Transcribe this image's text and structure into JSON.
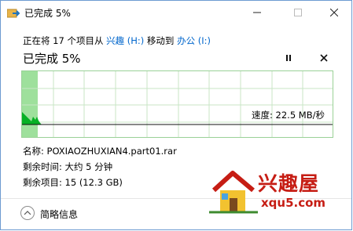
{
  "window": {
    "title": "已完成 5%"
  },
  "summary": {
    "prefix": "正在将 17 个项目从 ",
    "source": "兴趣 (H:)",
    "middle": " 移动到 ",
    "destination": "办公 (I:)"
  },
  "progress": {
    "title": "已完成 5%",
    "percent": 5,
    "speed": "速度: 22.5 MB/秒"
  },
  "info": {
    "name_label": "名称: ",
    "name_value": "POXIAOZHUXIAN4.part01.rar",
    "time_label": "剩余时间: ",
    "time_value": "大约 5 分钟",
    "items_label": "剩余项目: ",
    "items_value": "15 (12.3 GB)"
  },
  "details": {
    "label": "简略信息"
  },
  "watermark": {
    "text": "兴趣屋",
    "url": "xqu5.com"
  },
  "colors": {
    "link": "#0066cc",
    "graph_fill": "#06b025",
    "graph_fill_light": "#9ee09c",
    "graph_grid": "#c8e6c6",
    "logo": "#c61d14"
  }
}
